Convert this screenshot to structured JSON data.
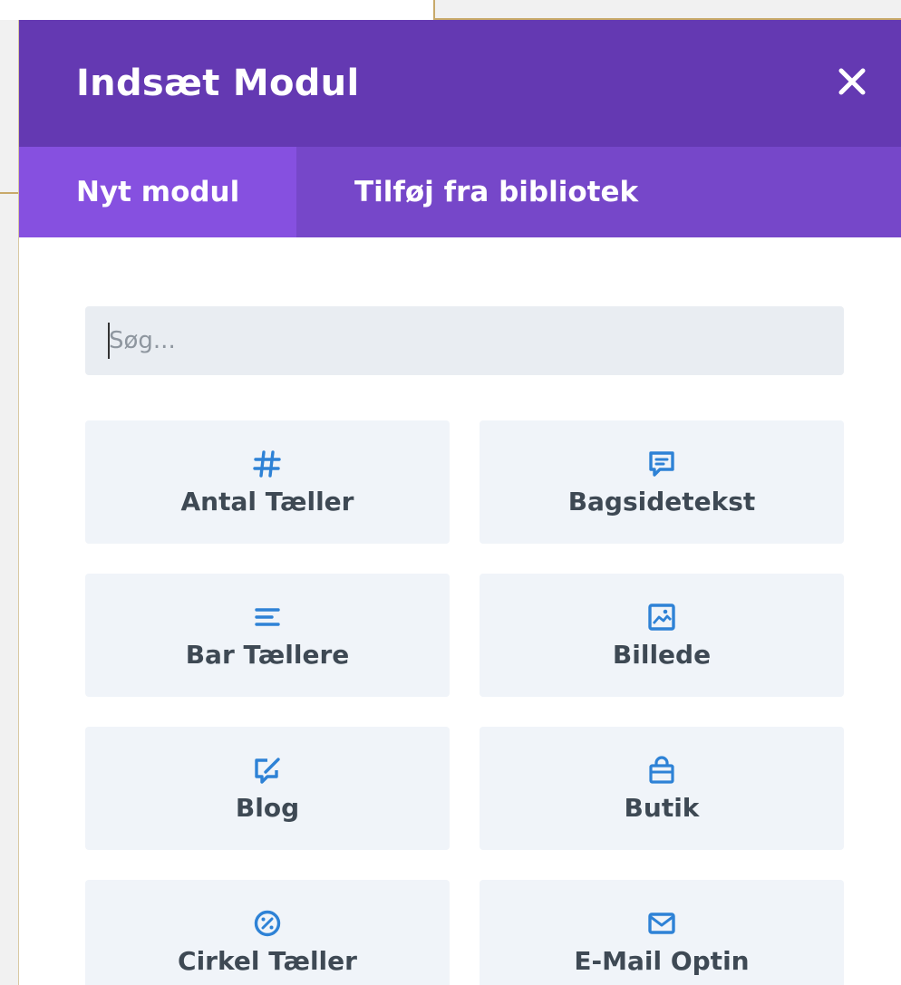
{
  "modal": {
    "title": "Indsæt Modul",
    "close_label": "×"
  },
  "tabs": [
    {
      "label": "Nyt modul",
      "active": true
    },
    {
      "label": "Tilføj fra bibliotek",
      "active": false
    }
  ],
  "search": {
    "placeholder": "Søg...",
    "value": ""
  },
  "modules": [
    {
      "label": "Antal Tæller",
      "icon": "hash-icon"
    },
    {
      "label": "Bagsidetekst",
      "icon": "comment-icon"
    },
    {
      "label": "Bar Tællere",
      "icon": "bars-icon"
    },
    {
      "label": "Billede",
      "icon": "image-icon"
    },
    {
      "label": "Blog",
      "icon": "blog-icon"
    },
    {
      "label": "Butik",
      "icon": "shop-icon"
    },
    {
      "label": "Cirkel Tæller",
      "icon": "circle-counter-icon"
    },
    {
      "label": "E-Mail Optin",
      "icon": "email-icon"
    }
  ],
  "colors": {
    "header": "#6439b2",
    "tabs": "#7647c9",
    "active_tab": "#8650e0",
    "icon": "#2e82d6",
    "module_bg": "#f0f4f9",
    "label": "#3e4954"
  }
}
